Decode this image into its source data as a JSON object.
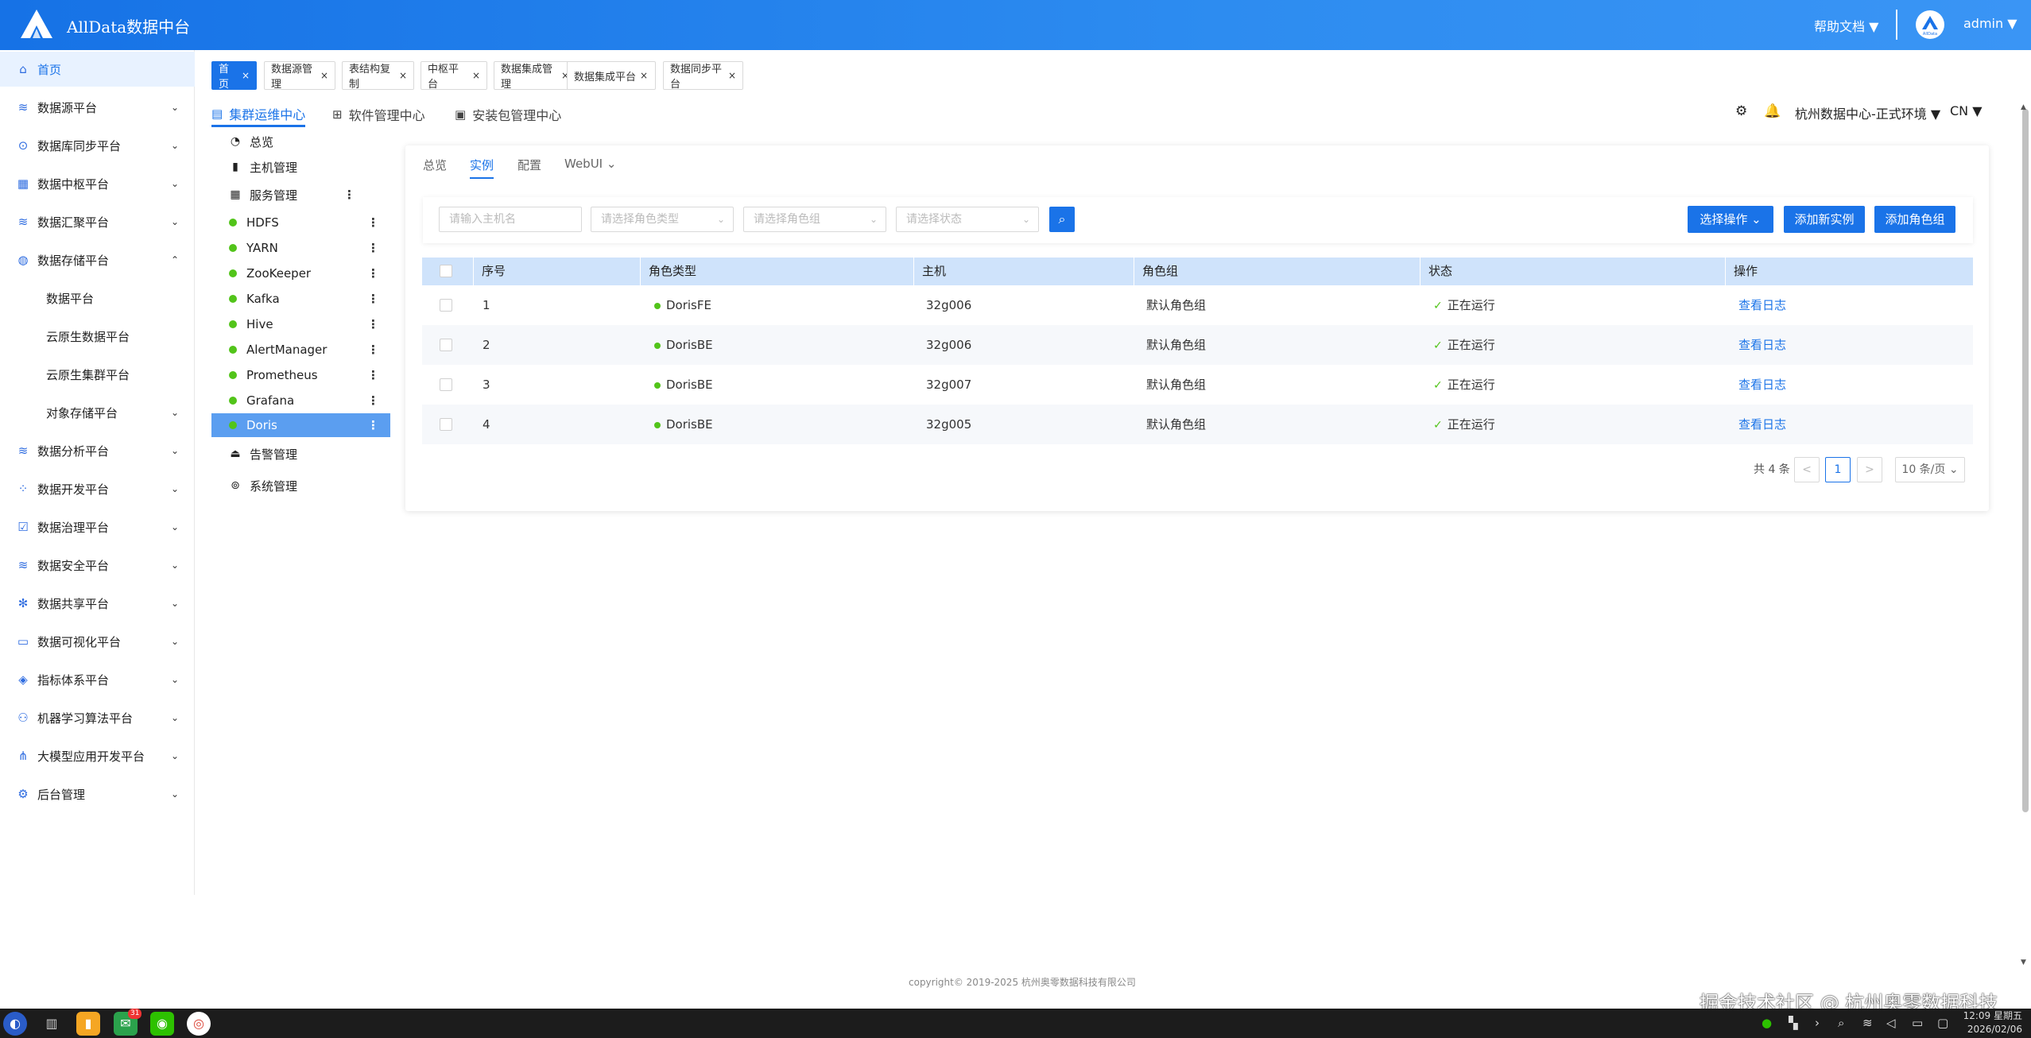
{
  "header": {
    "app_title": "AllData数据中台",
    "help": "帮助文档 ▼",
    "user": "admin ▼",
    "logo_icon": "triangle-logo-icon",
    "avatar_text": "AllData"
  },
  "sidebar": {
    "items": [
      {
        "label": "首页",
        "icon": "home-icon",
        "glyph": "⌂",
        "active": true
      },
      {
        "label": "数据源平台",
        "icon": "database-icon",
        "glyph": "≋",
        "chevron": "⌄"
      },
      {
        "label": "数据库同步平台",
        "icon": "shield-icon",
        "glyph": "⊙",
        "chevron": "⌄"
      },
      {
        "label": "数据中枢平台",
        "icon": "grid-icon",
        "glyph": "▦",
        "chevron": "⌄"
      },
      {
        "label": "数据汇聚平台",
        "icon": "stack-icon",
        "glyph": "≋",
        "chevron": "⌄"
      },
      {
        "label": "数据存储平台",
        "icon": "chart-icon",
        "glyph": "◍",
        "chevron": "⌃"
      },
      {
        "label": "数据平台",
        "sub": true
      },
      {
        "label": "云原生数据平台",
        "sub": true
      },
      {
        "label": "云原生集群平台",
        "sub": true
      },
      {
        "label": "对象存储平台",
        "sub": true,
        "chevron": "⌄"
      },
      {
        "label": "数据分析平台",
        "icon": "database-icon",
        "glyph": "≋",
        "chevron": "⌄"
      },
      {
        "label": "数据开发平台",
        "icon": "modules-icon",
        "glyph": "⁘",
        "chevron": "⌄"
      },
      {
        "label": "数据治理平台",
        "icon": "checklist-icon",
        "glyph": "☑",
        "chevron": "⌄"
      },
      {
        "label": "数据安全平台",
        "icon": "database-icon",
        "glyph": "≋",
        "chevron": "⌄"
      },
      {
        "label": "数据共享平台",
        "icon": "share-icon",
        "glyph": "✻",
        "chevron": "⌄"
      },
      {
        "label": "数据可视化平台",
        "icon": "monitor-icon",
        "glyph": "▭",
        "chevron": "⌄"
      },
      {
        "label": "指标体系平台",
        "icon": "cube-icon",
        "glyph": "◈",
        "chevron": "⌄"
      },
      {
        "label": "机器学习算法平台",
        "icon": "network-icon",
        "glyph": "⚇",
        "chevron": "⌄"
      },
      {
        "label": "大模型应用开发平台",
        "icon": "nodes-icon",
        "glyph": "⋔",
        "chevron": "⌄"
      },
      {
        "label": "后台管理",
        "icon": "settings-icon",
        "glyph": "⚙",
        "chevron": "⌄"
      }
    ]
  },
  "tags": [
    {
      "label": "首页",
      "active": true
    },
    {
      "label": "数据源管理"
    },
    {
      "label": "表结构复制"
    },
    {
      "label": "中枢平台"
    },
    {
      "label": "数据集成管理"
    },
    {
      "label": "数据集成平台"
    },
    {
      "label": "数据同步平台"
    }
  ],
  "main_tabs": [
    {
      "label": "集群运维中心",
      "icon": "document-icon",
      "glyph": "▤",
      "active": true
    },
    {
      "label": "软件管理中心",
      "icon": "apps-icon",
      "glyph": "⊞"
    },
    {
      "label": "安装包管理中心",
      "icon": "package-icon",
      "glyph": "▣"
    }
  ],
  "top_right": {
    "settings_glyph": "⚙",
    "bell_glyph": "🔔",
    "env": "杭州数据中心-正式环境 ▼",
    "lang": "CN ▼"
  },
  "tree": {
    "items": [
      {
        "label": "总览",
        "icon": "pie-chart-icon",
        "glyph": "◔"
      },
      {
        "label": "主机管理",
        "icon": "server-icon",
        "glyph": "▮"
      },
      {
        "label": "服务管理",
        "icon": "apps-icon",
        "glyph": "▦",
        "menu": "⋮"
      },
      {
        "label": "HDFS",
        "dot": true,
        "menu": "⋮"
      },
      {
        "label": "YARN",
        "dot": true,
        "menu": "⋮"
      },
      {
        "label": "ZooKeeper",
        "dot": true,
        "menu": "⋮"
      },
      {
        "label": "Kafka",
        "dot": true,
        "menu": "⋮"
      },
      {
        "label": "Hive",
        "dot": true,
        "menu": "⋮"
      },
      {
        "label": "AlertManager",
        "dot": true,
        "menu": "⋮"
      },
      {
        "label": "Prometheus",
        "dot": true,
        "menu": "⋮"
      },
      {
        "label": "Grafana",
        "dot": true,
        "menu": "⋮"
      },
      {
        "label": "Doris",
        "dot": true,
        "menu": "⋮",
        "selected": true
      },
      {
        "label": "告警管理",
        "icon": "alarm-icon",
        "glyph": "⏏"
      },
      {
        "label": "系统管理",
        "icon": "gear-icon",
        "glyph": "⊚"
      }
    ]
  },
  "sub_tabs": [
    {
      "label": "总览"
    },
    {
      "label": "实例",
      "active": true
    },
    {
      "label": "配置"
    },
    {
      "label": "WebUI ⌄"
    }
  ],
  "filters": {
    "host_placeholder": "请输入主机名",
    "role_type_placeholder": "请选择角色类型",
    "role_group_placeholder": "请选择角色组",
    "status_placeholder": "请选择状态",
    "search_glyph": "⌕",
    "select_op": "选择操作 ⌄",
    "add_instance": "添加新实例",
    "add_role_group": "添加角色组"
  },
  "table": {
    "columns": [
      "序号",
      "角色类型",
      "主机",
      "角色组",
      "状态",
      "操作"
    ],
    "rows": [
      {
        "no": "1",
        "role": "DorisFE",
        "host": "32g006",
        "group": "默认角色组",
        "status": "正在运行",
        "action": "查看日志"
      },
      {
        "no": "2",
        "role": "DorisBE",
        "host": "32g006",
        "group": "默认角色组",
        "status": "正在运行",
        "action": "查看日志"
      },
      {
        "no": "3",
        "role": "DorisBE",
        "host": "32g007",
        "group": "默认角色组",
        "status": "正在运行",
        "action": "查看日志"
      },
      {
        "no": "4",
        "role": "DorisBE",
        "host": "32g005",
        "group": "默认角色组",
        "status": "正在运行",
        "action": "查看日志"
      }
    ]
  },
  "pagination": {
    "total": "共 4 条",
    "prev": "<",
    "page": "1",
    "next": ">",
    "size": "10 条/页 ⌄"
  },
  "footer": "copyright© 2019-2025 杭州奥零数据科技有限公司",
  "watermark": "掘金技术社区 @ 杭州奥零数据科技",
  "taskbar": {
    "badge": "31",
    "clock_time": "12:09 星期五",
    "clock_date": "2026/02/06"
  },
  "colors": {
    "accent": "#1a73e8",
    "running": "#52c41a",
    "header_start": "#1672e6"
  }
}
